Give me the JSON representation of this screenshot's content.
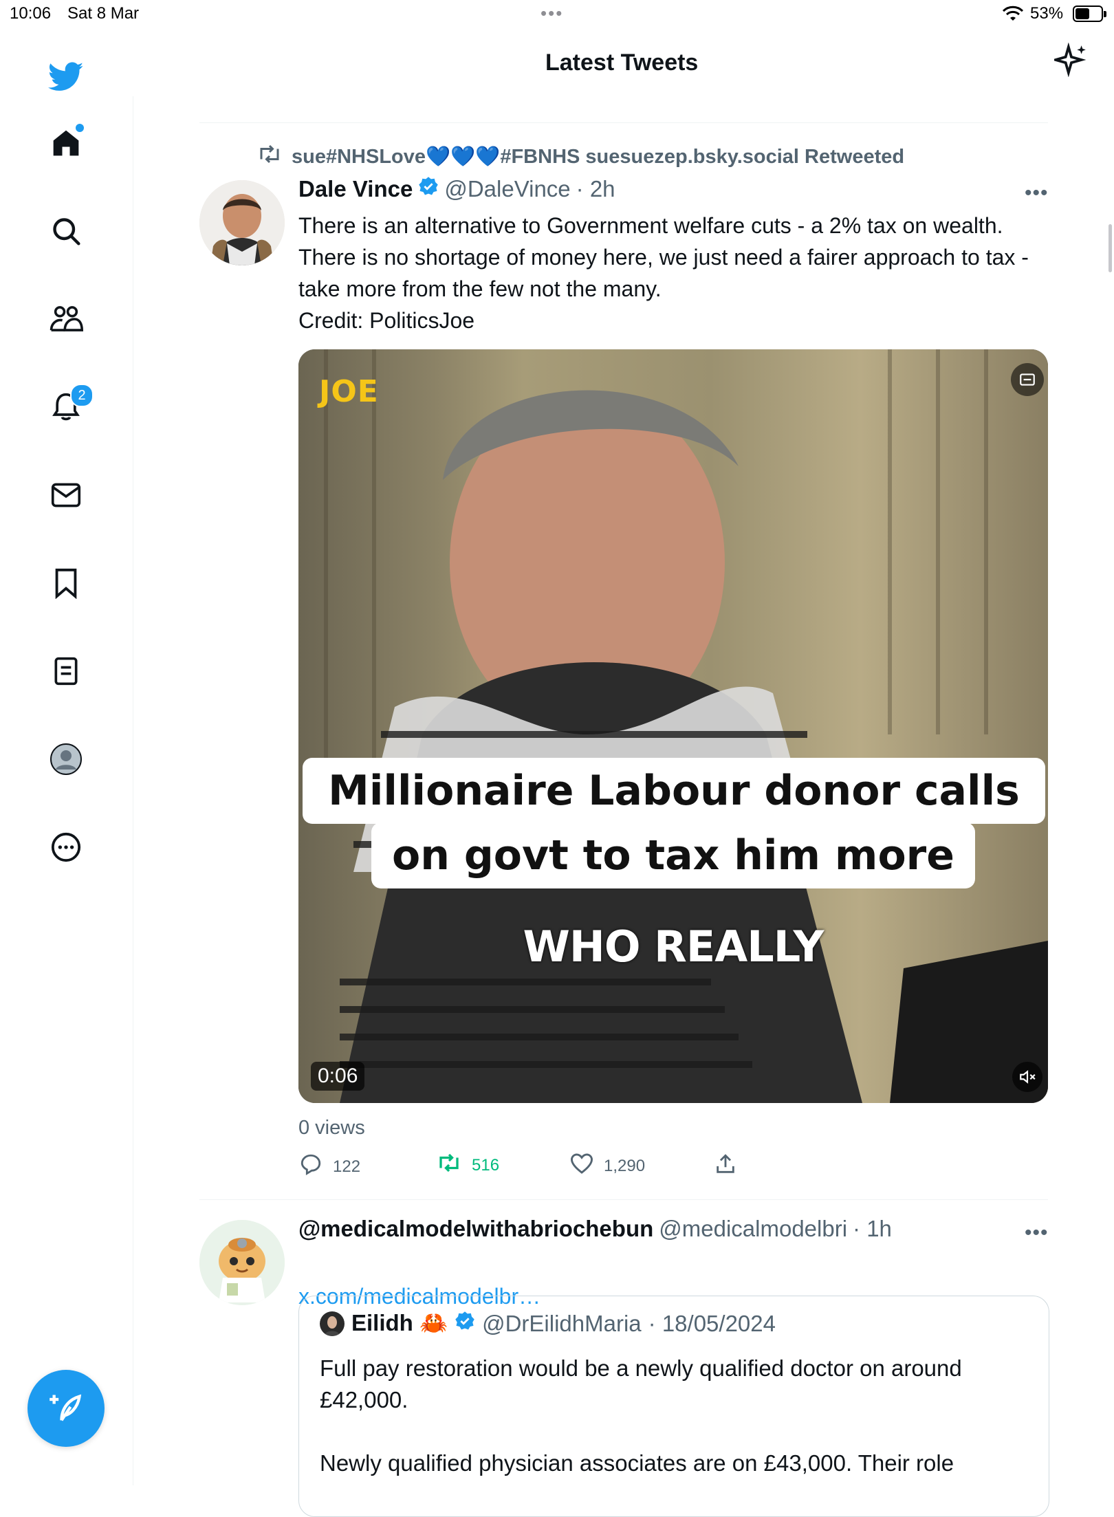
{
  "status_bar": {
    "time": "10:06",
    "date": "Sat 8 Mar",
    "battery": "53%"
  },
  "header": {
    "title": "Latest Tweets"
  },
  "sidebar": {
    "items": [
      {
        "name": "home"
      },
      {
        "name": "search"
      },
      {
        "name": "communities"
      },
      {
        "name": "notifications",
        "badge": "2"
      },
      {
        "name": "messages"
      },
      {
        "name": "bookmarks"
      },
      {
        "name": "lists"
      },
      {
        "name": "profile"
      },
      {
        "name": "more"
      }
    ]
  },
  "tweet1": {
    "retweeted_by": "sue#NHSLove💙💙💙#FBNHS suesuezep.bsky.social Retweeted",
    "name": "Dale Vince",
    "handle": "@DaleVince",
    "time": "· 2h",
    "text": "There is an alternative to Government welfare cuts - a 2% tax on wealth. There is no shortage of money here, we just need a fairer approach to tax - take more from the few not the many.\nCredit: PoliticsJoe",
    "video": {
      "logo": "JOE",
      "caption_line1": "Millionaire Labour donor calls",
      "caption_line2": "on govt to tax him more",
      "subtitle": "WHO REALLY",
      "duration": "0:06"
    },
    "views": "0 views",
    "replies": "122",
    "retweets": "516",
    "likes": "1,290",
    "retweet_active_color": "#00ba7c"
  },
  "tweet2": {
    "name": "@medicalmodelwithabriochebun",
    "handle": "@medicalmodelbri",
    "time": "· 1h",
    "link": "x.com/medicalmodelbr…",
    "quote": {
      "name": "Eilidh 🦀",
      "handle": "@DrEilidhMaria",
      "date": "· 18/05/2024",
      "text": "Full pay restoration would be a newly qualified doctor on around £42,000.\n\nNewly qualified physician associates are on £43,000. Their role"
    }
  },
  "colors": {
    "accent": "#1d9bf0",
    "secondary_text": "#536471",
    "border": "#eff3f4"
  }
}
